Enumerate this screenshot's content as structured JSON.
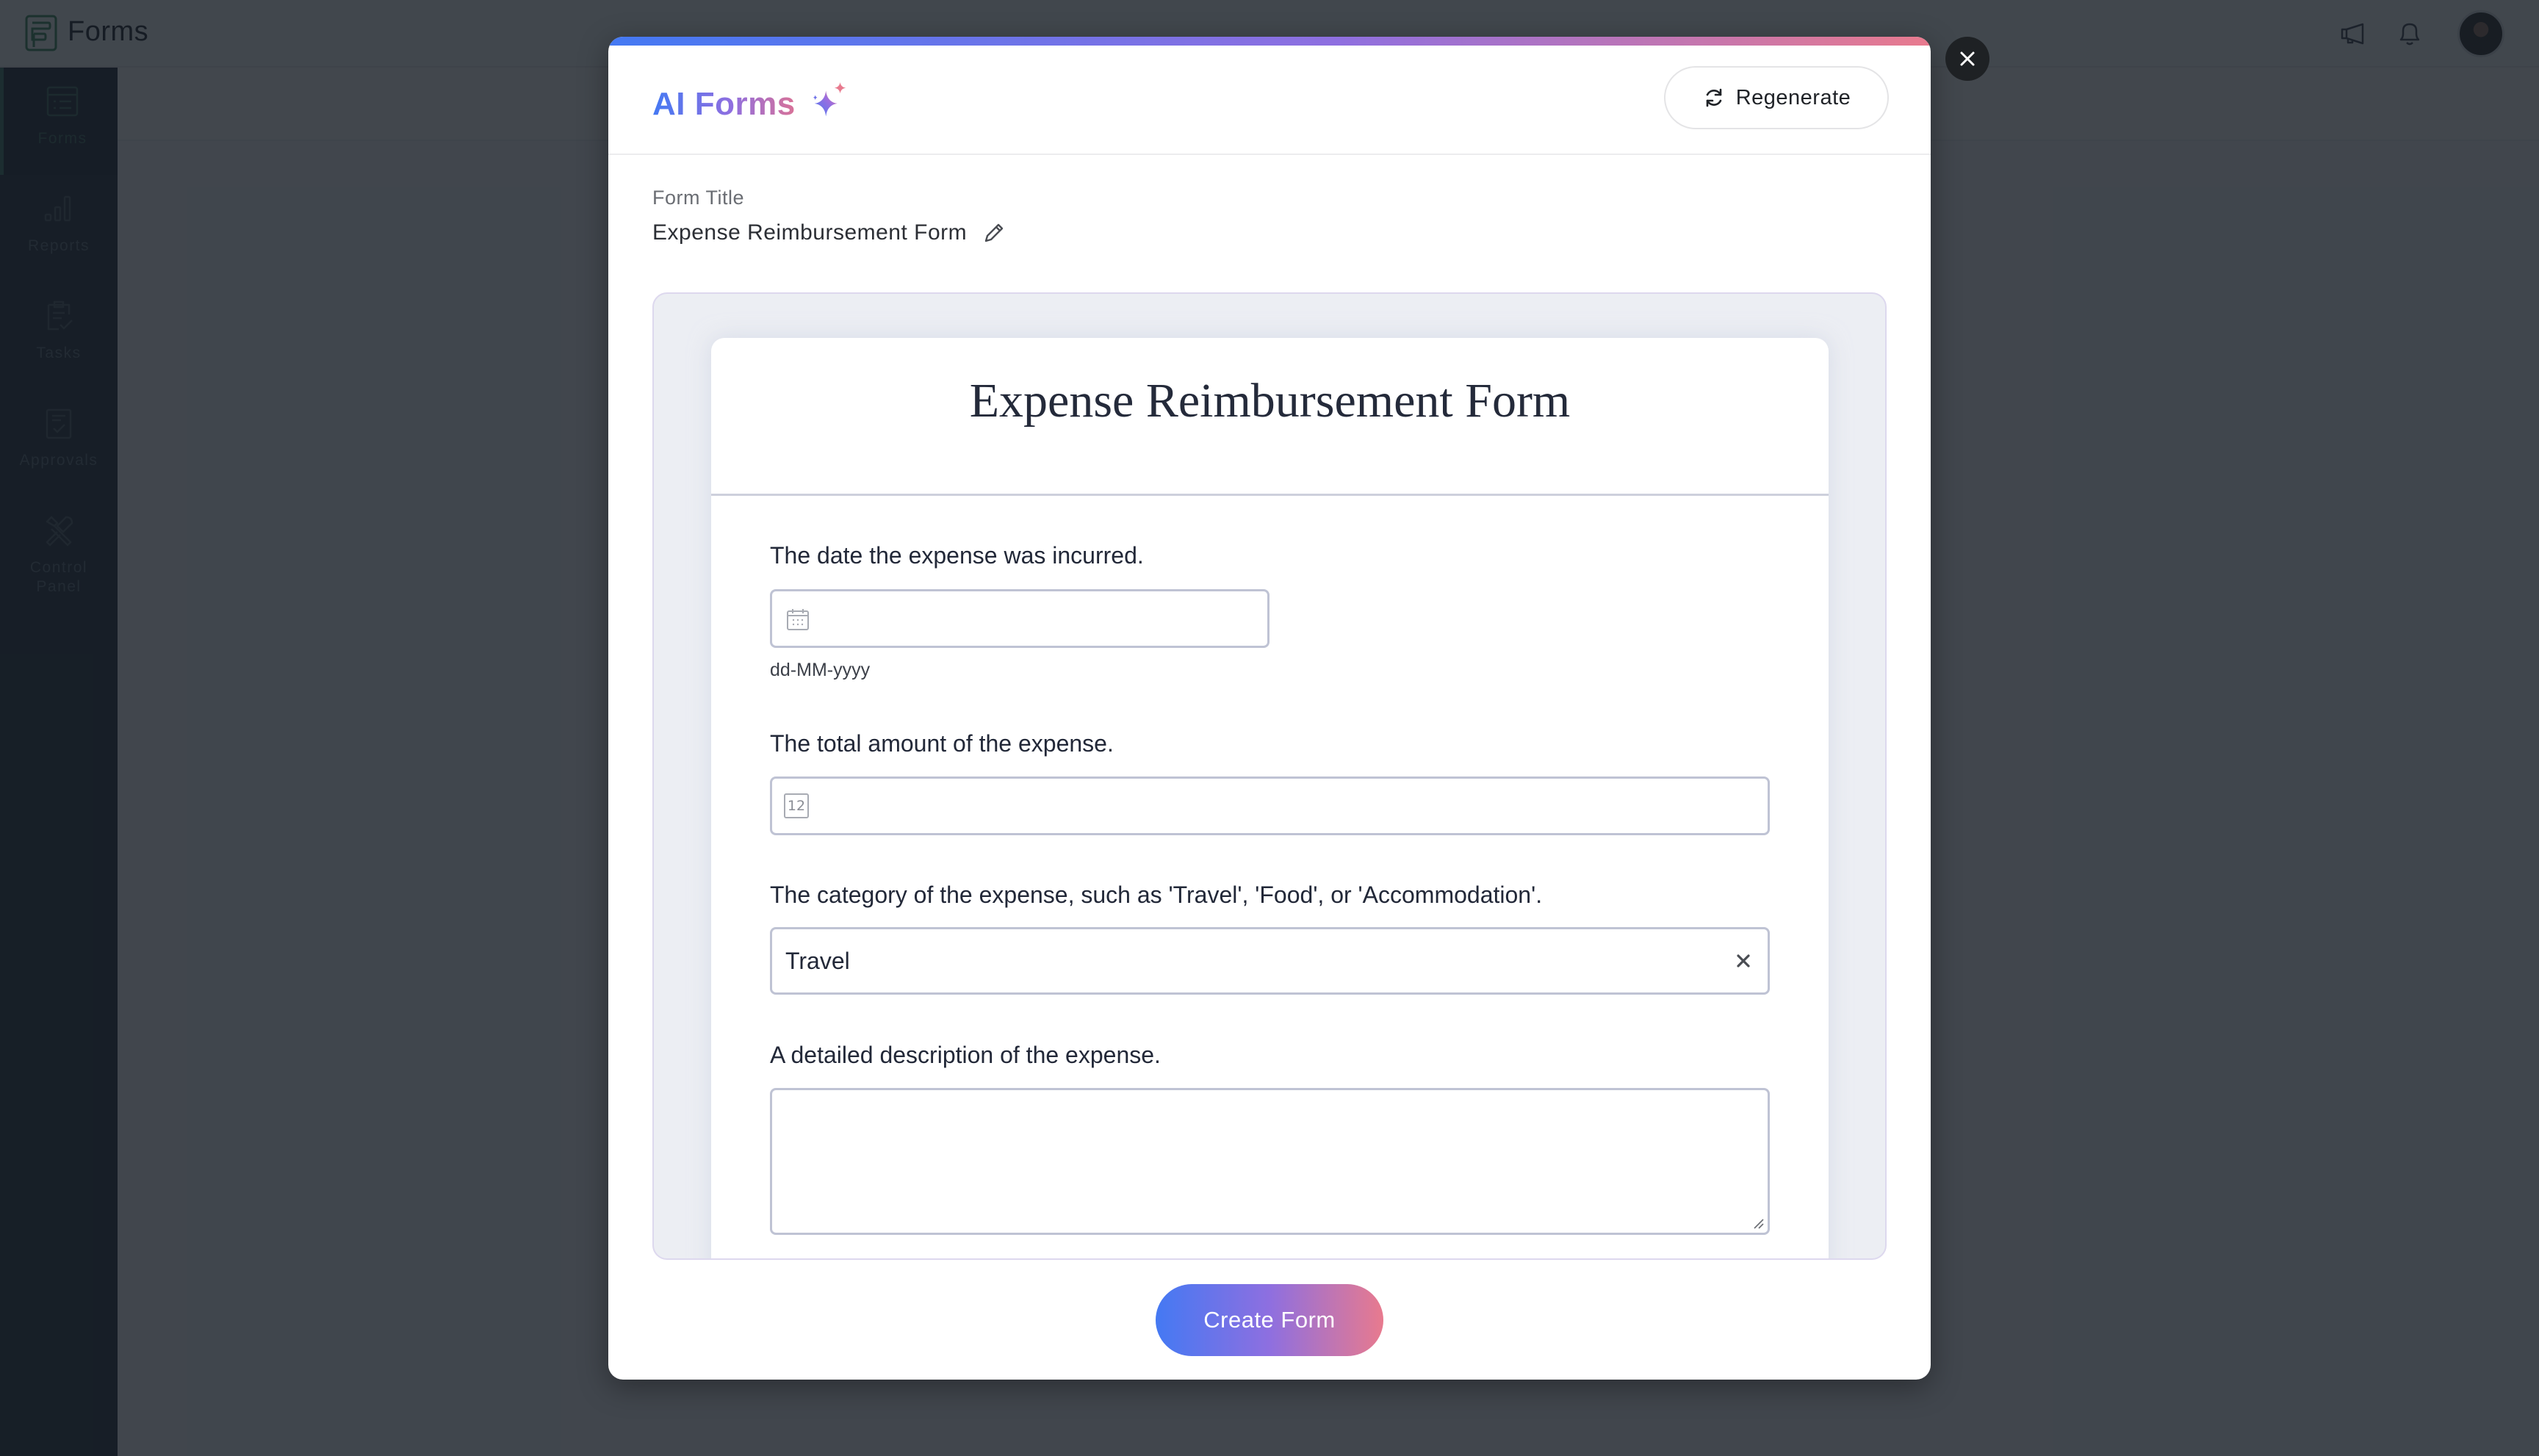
{
  "app": {
    "title": "Forms",
    "top_icons": [
      "megaphone-icon",
      "bell-icon"
    ],
    "avatar": "user-avatar"
  },
  "sidebar": {
    "items": [
      {
        "label": "Forms",
        "icon": "forms-list-icon",
        "active": true
      },
      {
        "label": "Reports",
        "icon": "bar-chart-icon",
        "active": false
      },
      {
        "label": "Tasks",
        "icon": "clipboard-check-icon",
        "active": false
      },
      {
        "label": "Approvals",
        "icon": "approval-check-icon",
        "active": false
      },
      {
        "label": "Control",
        "label2": "Panel",
        "icon": "tools-icon",
        "active": false
      }
    ]
  },
  "modal": {
    "title": "AI Forms",
    "regenerate_label": "Regenerate",
    "form_title_label": "Form Title",
    "form_title_value": "Expense Reimbursement Form",
    "create_label": "Create Form",
    "colors": {
      "gradient_start": "#4479f3",
      "gradient_mid": "#8e6fe0",
      "gradient_end": "#e87a8e"
    }
  },
  "preview": {
    "title": "Expense Reimbursement Form",
    "fields": [
      {
        "label": "The date the expense was incurred.",
        "type": "date",
        "value": "",
        "hint": "dd-MM-yyyy"
      },
      {
        "label": "The total amount of the expense.",
        "type": "number",
        "value": "",
        "icon_text": "12"
      },
      {
        "label": "The category of the expense, such as 'Travel', 'Food', or 'Accommodation'.",
        "type": "select",
        "value": "Travel"
      },
      {
        "label": "A detailed description of the expense.",
        "type": "textarea",
        "value": ""
      }
    ]
  }
}
